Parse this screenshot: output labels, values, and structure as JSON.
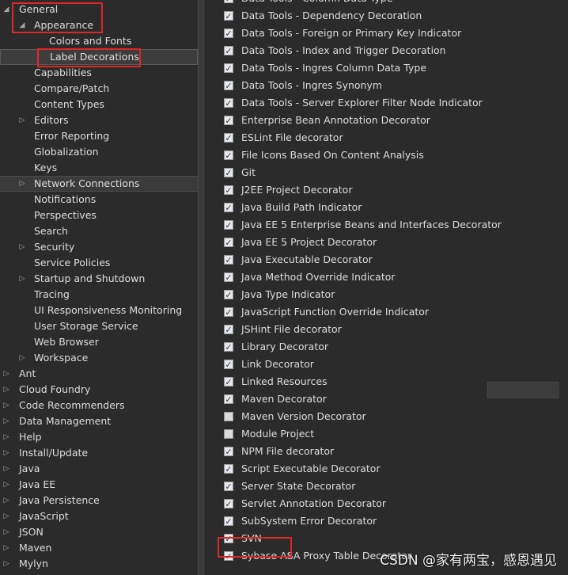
{
  "tree": {
    "items": [
      {
        "label": "General",
        "depth": 0,
        "arrow": "expanded",
        "state": ""
      },
      {
        "label": "Appearance",
        "depth": 1,
        "arrow": "expanded",
        "state": ""
      },
      {
        "label": "Colors and Fonts",
        "depth": 2,
        "arrow": "",
        "state": ""
      },
      {
        "label": "Label Decorations",
        "depth": 2,
        "arrow": "",
        "state": "selected"
      },
      {
        "label": "Capabilities",
        "depth": 1,
        "arrow": "",
        "state": ""
      },
      {
        "label": "Compare/Patch",
        "depth": 1,
        "arrow": "",
        "state": ""
      },
      {
        "label": "Content Types",
        "depth": 1,
        "arrow": "",
        "state": ""
      },
      {
        "label": "Editors",
        "depth": 1,
        "arrow": "collapsed",
        "state": ""
      },
      {
        "label": "Error Reporting",
        "depth": 1,
        "arrow": "",
        "state": ""
      },
      {
        "label": "Globalization",
        "depth": 1,
        "arrow": "",
        "state": ""
      },
      {
        "label": "Keys",
        "depth": 1,
        "arrow": "",
        "state": ""
      },
      {
        "label": "Network Connections",
        "depth": 1,
        "arrow": "collapsed",
        "state": "hover"
      },
      {
        "label": "Notifications",
        "depth": 1,
        "arrow": "",
        "state": ""
      },
      {
        "label": "Perspectives",
        "depth": 1,
        "arrow": "",
        "state": ""
      },
      {
        "label": "Search",
        "depth": 1,
        "arrow": "",
        "state": ""
      },
      {
        "label": "Security",
        "depth": 1,
        "arrow": "collapsed",
        "state": ""
      },
      {
        "label": "Service Policies",
        "depth": 1,
        "arrow": "",
        "state": ""
      },
      {
        "label": "Startup and Shutdown",
        "depth": 1,
        "arrow": "collapsed",
        "state": ""
      },
      {
        "label": "Tracing",
        "depth": 1,
        "arrow": "",
        "state": ""
      },
      {
        "label": "UI Responsiveness Monitoring",
        "depth": 1,
        "arrow": "",
        "state": ""
      },
      {
        "label": "User Storage Service",
        "depth": 1,
        "arrow": "",
        "state": ""
      },
      {
        "label": "Web Browser",
        "depth": 1,
        "arrow": "",
        "state": ""
      },
      {
        "label": "Workspace",
        "depth": 1,
        "arrow": "collapsed",
        "state": ""
      },
      {
        "label": "Ant",
        "depth": 0,
        "arrow": "collapsed",
        "state": ""
      },
      {
        "label": "Cloud Foundry",
        "depth": 0,
        "arrow": "collapsed",
        "state": ""
      },
      {
        "label": "Code Recommenders",
        "depth": 0,
        "arrow": "collapsed",
        "state": ""
      },
      {
        "label": "Data Management",
        "depth": 0,
        "arrow": "collapsed",
        "state": ""
      },
      {
        "label": "Help",
        "depth": 0,
        "arrow": "collapsed",
        "state": ""
      },
      {
        "label": "Install/Update",
        "depth": 0,
        "arrow": "collapsed",
        "state": ""
      },
      {
        "label": "Java",
        "depth": 0,
        "arrow": "collapsed",
        "state": ""
      },
      {
        "label": "Java EE",
        "depth": 0,
        "arrow": "collapsed",
        "state": ""
      },
      {
        "label": "Java Persistence",
        "depth": 0,
        "arrow": "collapsed",
        "state": ""
      },
      {
        "label": "JavaScript",
        "depth": 0,
        "arrow": "collapsed",
        "state": ""
      },
      {
        "label": "JSON",
        "depth": 0,
        "arrow": "collapsed",
        "state": ""
      },
      {
        "label": "Maven",
        "depth": 0,
        "arrow": "collapsed",
        "state": ""
      },
      {
        "label": "Mylyn",
        "depth": 0,
        "arrow": "collapsed",
        "state": ""
      }
    ]
  },
  "decorators": {
    "items": [
      {
        "label": "Data Tools - Column Data Type",
        "checked": true
      },
      {
        "label": "Data Tools - Dependency Decoration",
        "checked": true
      },
      {
        "label": "Data Tools - Foreign or Primary Key Indicator",
        "checked": true
      },
      {
        "label": "Data Tools - Index and Trigger Decoration",
        "checked": true
      },
      {
        "label": "Data Tools - Ingres Column Data Type",
        "checked": true
      },
      {
        "label": "Data Tools - Ingres Synonym",
        "checked": true
      },
      {
        "label": "Data Tools - Server Explorer Filter Node Indicator",
        "checked": true
      },
      {
        "label": "Enterprise Bean Annotation Decorator",
        "checked": true
      },
      {
        "label": "ESLint File decorator",
        "checked": true
      },
      {
        "label": "File Icons Based On Content Analysis",
        "checked": true
      },
      {
        "label": "Git",
        "checked": true
      },
      {
        "label": "J2EE Project Decorator",
        "checked": true
      },
      {
        "label": "Java Build Path Indicator",
        "checked": true
      },
      {
        "label": "Java EE 5 Enterprise Beans and Interfaces Decorator",
        "checked": true
      },
      {
        "label": "Java EE 5 Project Decorator",
        "checked": true
      },
      {
        "label": "Java Executable Decorator",
        "checked": true
      },
      {
        "label": "Java Method Override Indicator",
        "checked": true
      },
      {
        "label": "Java Type Indicator",
        "checked": true
      },
      {
        "label": "JavaScript Function Override Indicator",
        "checked": true
      },
      {
        "label": "JSHint File decorator",
        "checked": true
      },
      {
        "label": "Library Decorator",
        "checked": true
      },
      {
        "label": "Link Decorator",
        "checked": true
      },
      {
        "label": "Linked Resources",
        "checked": true
      },
      {
        "label": "Maven Decorator",
        "checked": true
      },
      {
        "label": "Maven Version Decorator",
        "checked": false
      },
      {
        "label": "Module Project",
        "checked": false
      },
      {
        "label": "NPM File decorator",
        "checked": true
      },
      {
        "label": "Script Executable Decorator",
        "checked": true
      },
      {
        "label": "Server State Decorator",
        "checked": true
      },
      {
        "label": "Servlet Annotation Decorator",
        "checked": true
      },
      {
        "label": "SubSystem Error Decorator",
        "checked": true
      },
      {
        "label": "SVN",
        "checked": true
      },
      {
        "label": "Sybase ASA Proxy Table Decorator",
        "checked": true
      }
    ]
  },
  "watermark": "CSDN @家有两宝，感恩遇见",
  "colors": {
    "highlight_box": "#e0262a",
    "background": "#2b2b2b",
    "text": "#dcdcdc"
  }
}
